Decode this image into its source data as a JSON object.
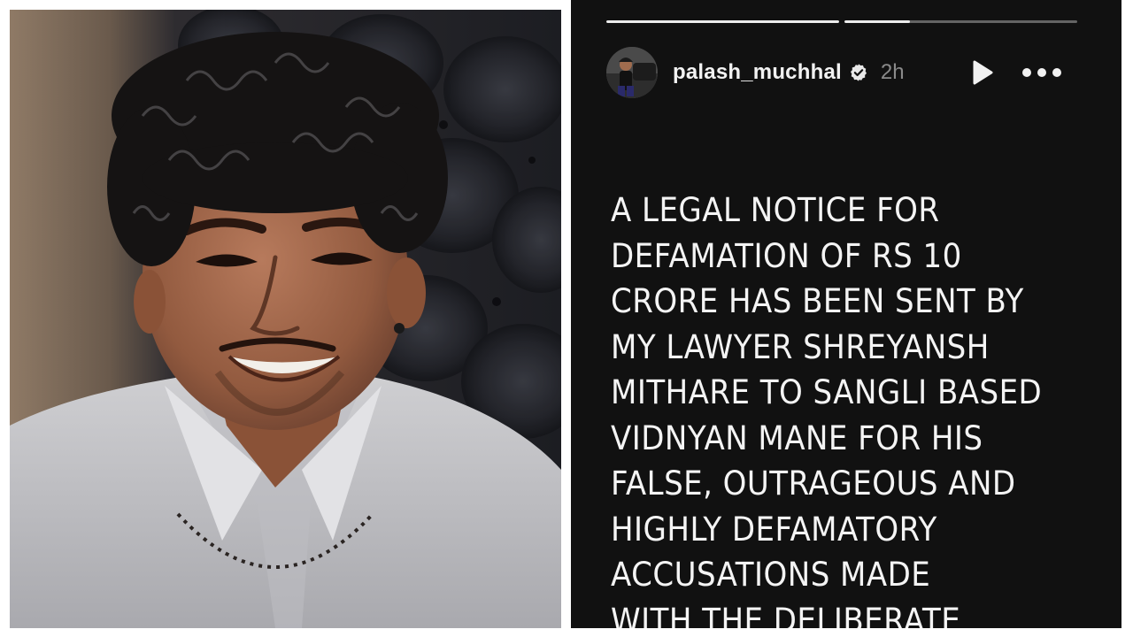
{
  "story": {
    "username": "palash_muchhal",
    "time_ago": "2h",
    "progress": [
      1.0,
      0.28
    ],
    "text_lines": [
      "A LEGAL NOTICE FOR",
      "DEFAMATION OF RS 10",
      "CRORE HAS BEEN SENT BY",
      "MY LAWYER SHREYANSH",
      "MITHARE TO SANGLI BASED",
      "VIDNYAN MANE FOR HIS",
      "FALSE, OUTRAGEOUS AND",
      "HIGHLY DEFAMATORY",
      "ACCUSATIONS MADE",
      "WITH THE DELIBERATE"
    ],
    "icons": {
      "verified": "verified-badge-icon",
      "play": "play-icon",
      "more": "more-options-icon"
    }
  },
  "colors": {
    "story_background": "#111111",
    "text": "#f4f4f4",
    "time": "#8a8a8a"
  }
}
